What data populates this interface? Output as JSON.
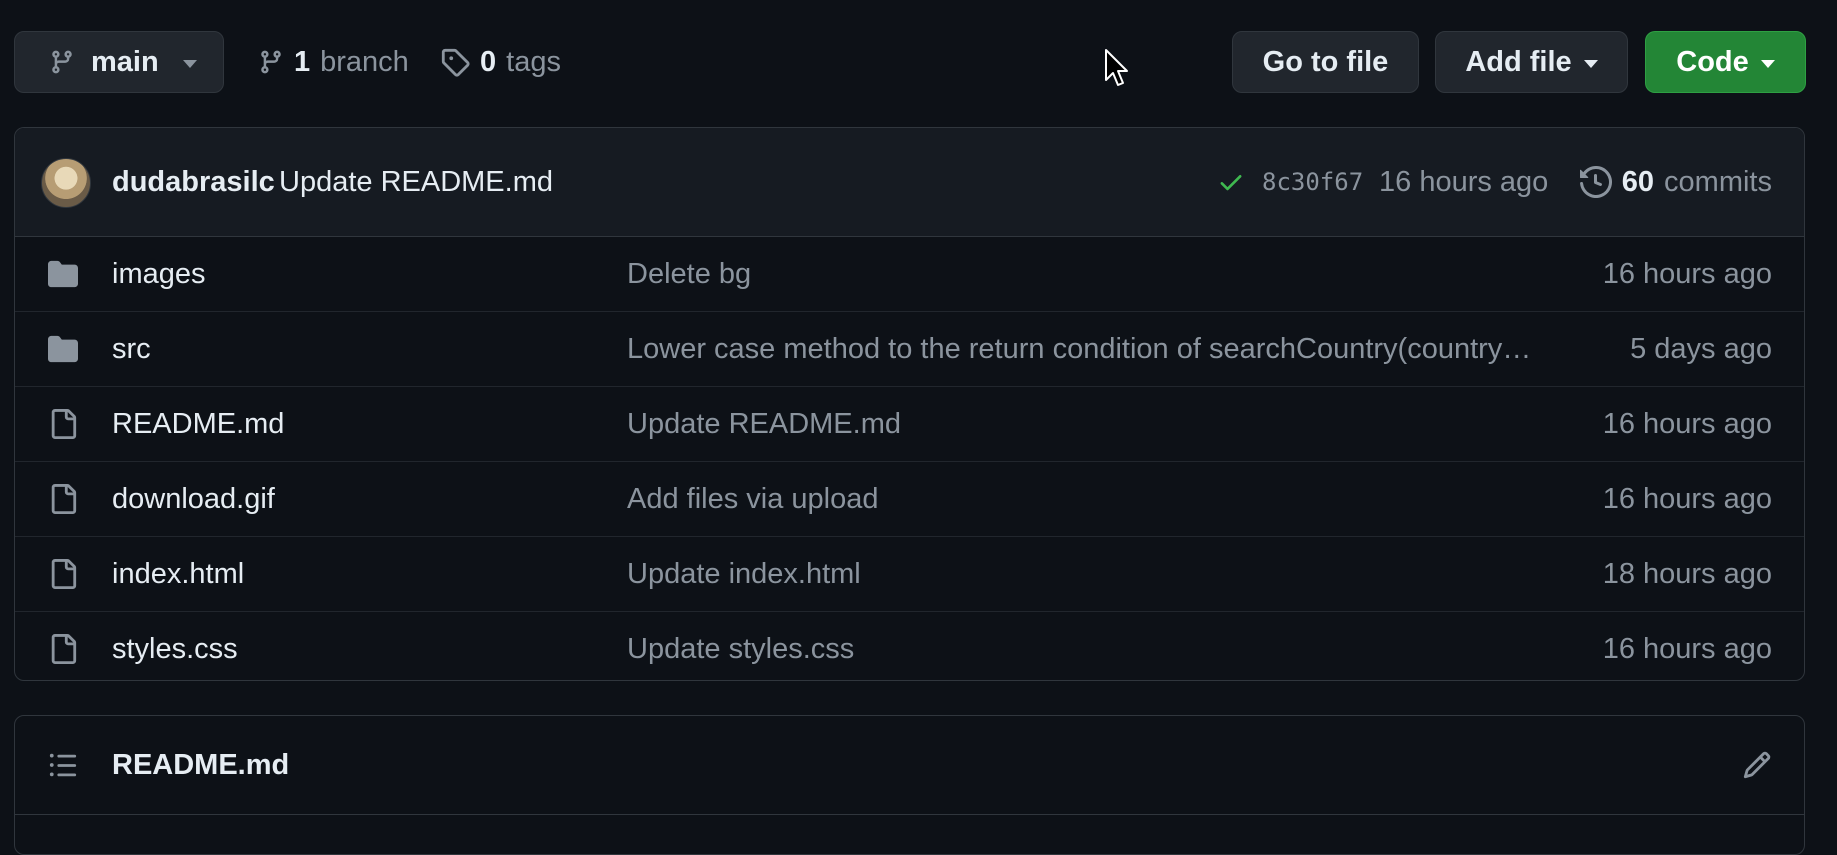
{
  "toolbar": {
    "branch_selector": "main",
    "branches_count": "1",
    "branches_label": "branch",
    "tags_count": "0",
    "tags_label": "tags",
    "go_to_file": "Go to file",
    "add_file": "Add file",
    "code": "Code"
  },
  "latest_commit": {
    "author": "dudabrasilc",
    "message": "Update README.md",
    "sha": "8c30f67",
    "time": "16 hours ago",
    "commits_count": "60",
    "commits_label": "commits",
    "status": "success"
  },
  "files": [
    {
      "type": "folder",
      "name": "images",
      "message": "Delete bg",
      "age": "16 hours ago"
    },
    {
      "type": "folder",
      "name": "src",
      "message": "Lower case method to the return condition of searchCountry(country…",
      "age": "5 days ago"
    },
    {
      "type": "file",
      "name": "README.md",
      "message": "Update README.md",
      "age": "16 hours ago"
    },
    {
      "type": "file",
      "name": "download.gif",
      "message": "Add files via upload",
      "age": "16 hours ago"
    },
    {
      "type": "file",
      "name": "index.html",
      "message": "Update index.html",
      "age": "18 hours ago"
    },
    {
      "type": "file",
      "name": "styles.css",
      "message": "Update styles.css",
      "age": "16 hours ago"
    }
  ],
  "readme": {
    "title": "README.md"
  },
  "colors": {
    "background": "#0d1117",
    "header": "#161b22",
    "border": "#30363d",
    "primary_button": "#238636",
    "muted_text": "#8b949e",
    "success": "#3fb950"
  },
  "icons": {
    "branch": "git-branch-icon",
    "tag": "tag-icon",
    "folder": "folder-icon",
    "file": "file-icon",
    "history": "history-icon",
    "check": "check-icon",
    "list": "list-icon",
    "edit": "pencil-icon"
  }
}
